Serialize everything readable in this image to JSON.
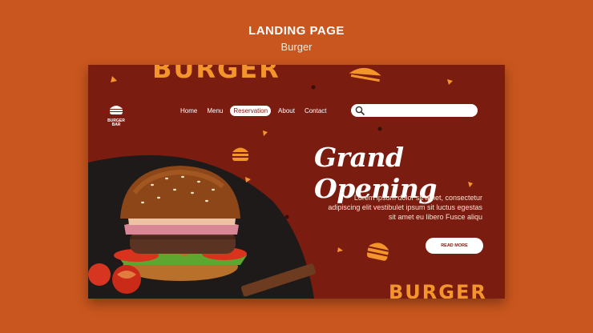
{
  "header": {
    "title": "LANDING PAGE",
    "subtitle": "Burger"
  },
  "card": {
    "brand_top": "BURGER",
    "brand_bottom": "BURGER",
    "logo": {
      "line1": "BURGER",
      "line2": "BAR"
    },
    "nav": [
      {
        "label": "Home",
        "active": false
      },
      {
        "label": "Menu",
        "active": false
      },
      {
        "label": "Reservation",
        "active": true
      },
      {
        "label": "About",
        "active": false
      },
      {
        "label": "Contact",
        "active": false
      }
    ],
    "search": {
      "placeholder": ""
    },
    "hero_title": "Grand Opening",
    "hero_text": "Lorem ipsum dolor sit amet, consectetur adipiscing elit vestibulet ipsum sit luctus egestas sit amet eu libero Fusce aliqu",
    "cta_label": "READ MORE"
  },
  "colors": {
    "background": "#c9561e",
    "card": "#7a1c10",
    "accent": "#f3952b",
    "white": "#ffffff"
  }
}
